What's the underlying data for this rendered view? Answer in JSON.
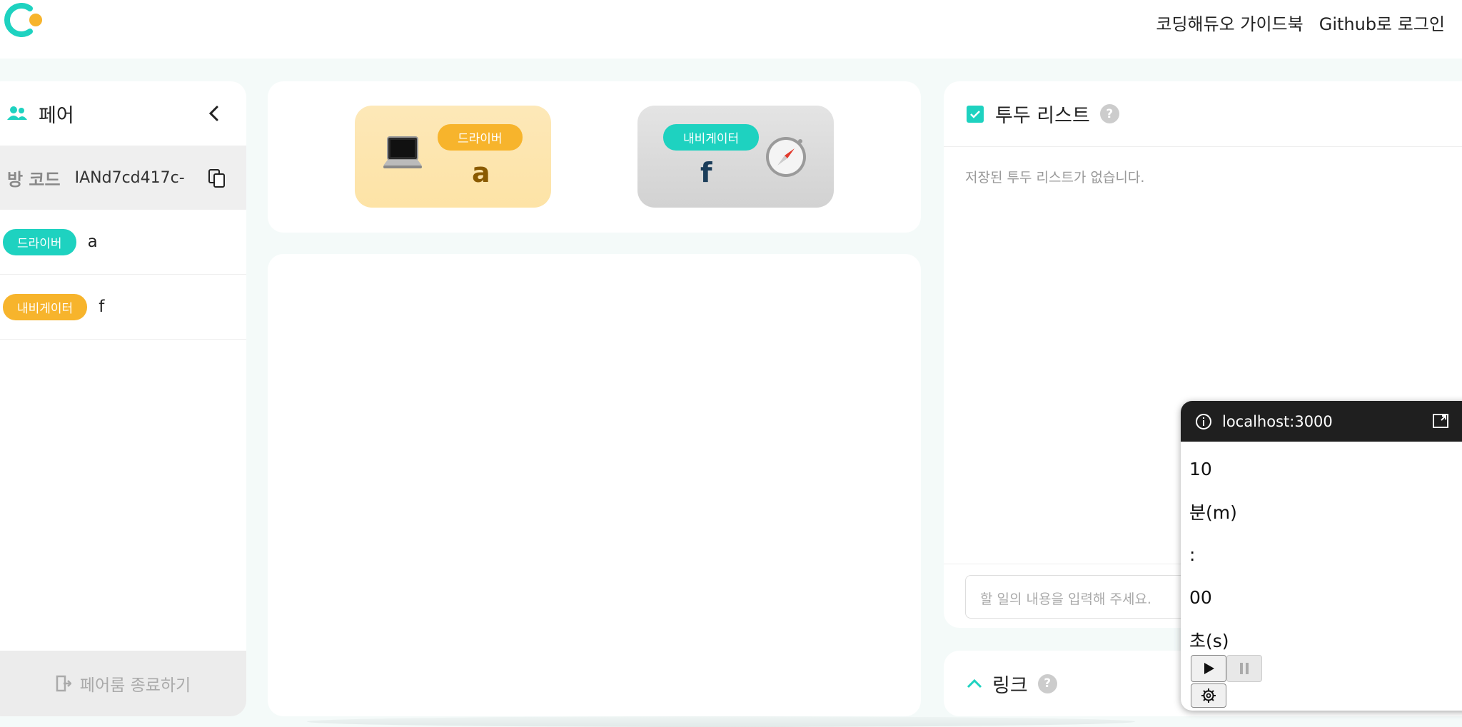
{
  "header": {
    "guide_link": "코딩해듀오 가이드북",
    "login_link": "Github로 로그인",
    "colors": {
      "brand_teal": "#1ed2c0",
      "brand_amber": "#f7b42c"
    }
  },
  "sidebar": {
    "title": "페어",
    "room_label": "방 코드",
    "room_code": "IANd7cd417c-",
    "members": [
      {
        "role": "드라이버",
        "name": "a"
      },
      {
        "role": "내비게이터",
        "name": "f"
      }
    ],
    "exit_label": "페어룸 종료하기"
  },
  "roles": {
    "driver": {
      "role": "드라이버",
      "name": "a",
      "icon": "laptop-icon"
    },
    "navigator": {
      "role": "내비게이터",
      "name": "f",
      "icon": "compass-icon"
    }
  },
  "todo": {
    "title": "투두 리스트",
    "help": "?",
    "empty_message": "저장된 투두 리스트가 없습니다.",
    "input_placeholder": "할 일의 내용을 입력해 주세요."
  },
  "link_section": {
    "title": "링크",
    "help": "?"
  },
  "timer_popup": {
    "url": "localhost:3000",
    "minutes": "10",
    "minutes_unit": "분(m)",
    "separator": ":",
    "seconds": "00",
    "seconds_unit": "초(s)"
  }
}
